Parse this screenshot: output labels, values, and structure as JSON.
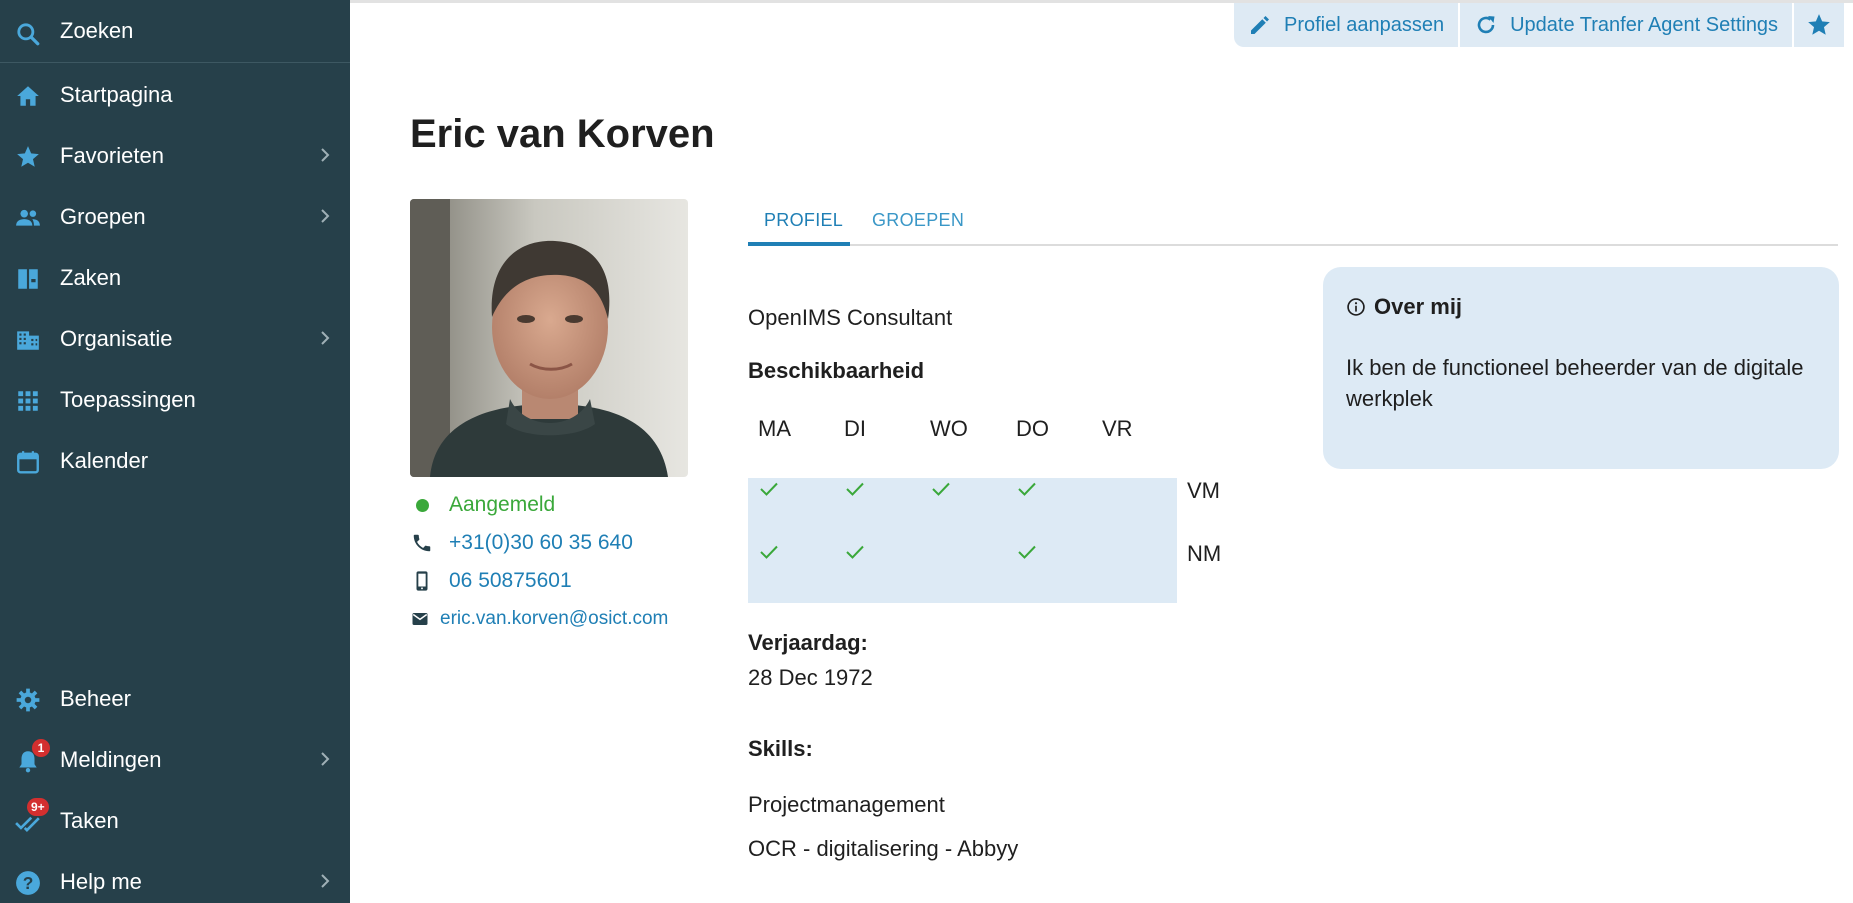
{
  "sidebar": {
    "top_items": [
      {
        "label": "Zoeken",
        "icon": "search-icon"
      },
      {
        "label": "Startpagina",
        "icon": "home-icon"
      },
      {
        "label": "Favorieten",
        "icon": "star-icon"
      },
      {
        "label": "Groepen",
        "icon": "people-icon"
      },
      {
        "label": "Zaken",
        "icon": "folders-icon"
      },
      {
        "label": "Organisatie",
        "icon": "building-icon"
      },
      {
        "label": "Toepassingen",
        "icon": "apps-grid-icon"
      },
      {
        "label": "Kalender",
        "icon": "calendar-icon"
      }
    ],
    "bottom_items": [
      {
        "label": "Beheer",
        "icon": "gear-icon"
      },
      {
        "label": "Meldingen",
        "icon": "bell-icon",
        "badge": "1"
      },
      {
        "label": "Taken",
        "icon": "double-check-icon",
        "badge": "9+"
      },
      {
        "label": "Help me",
        "icon": "help-icon"
      }
    ]
  },
  "actions": {
    "edit_profile": "Profiel aanpassen",
    "update_settings": "Update Tranfer Agent Settings"
  },
  "profile": {
    "name": "Eric van Korven",
    "status": "Aangemeld",
    "phone": "+31(0)30 60 35 640",
    "mobile": "06 50875601",
    "email": "eric.van.korven@osict.com",
    "role": "OpenIMS Consultant"
  },
  "tabs": {
    "profile": "PROFIEL",
    "groups": "GROEPEN"
  },
  "availability": {
    "heading": "Beschikbaarheid",
    "days": [
      "MA",
      "DI",
      "WO",
      "DO",
      "VR"
    ],
    "rows": [
      {
        "label": "VM",
        "available": [
          true,
          true,
          true,
          true,
          false
        ]
      },
      {
        "label": "NM",
        "available": [
          true,
          true,
          false,
          true,
          false
        ]
      }
    ]
  },
  "birthday": {
    "label": "Verjaardag:",
    "value": "28 Dec 1972"
  },
  "skills": {
    "label": "Skills:",
    "items": [
      "Projectmanagement",
      "OCR - digitalisering - Abbyy"
    ]
  },
  "about": {
    "heading": "Over mij",
    "text": "Ik ben de functioneel beheerder van de digitale werkplek"
  },
  "colors": {
    "sidebar": "#26404a",
    "accent": "#1f7fb5",
    "icon": "#4aa8db",
    "online": "#3aa83a",
    "panel": "#ddeaf5"
  }
}
